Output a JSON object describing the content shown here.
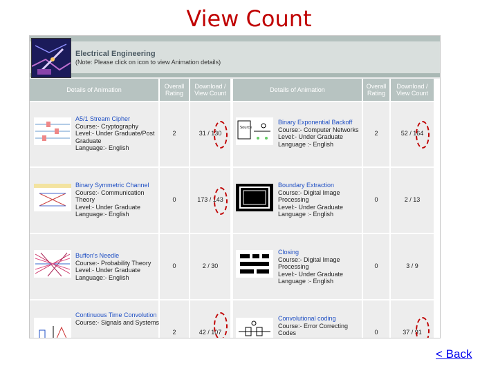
{
  "title": "View Count",
  "banner": {
    "dept": "Electrical Engineering",
    "note": "(Note: Please click on icon to view Animation details)"
  },
  "headers": {
    "details": "Details of Animation",
    "rating": "Overall Rating",
    "download": "Download / View Count"
  },
  "rows": [
    {
      "left": {
        "title": "A5/1 Stream Cipher",
        "course": "Course:- Cryptography",
        "level": "Level:- Under Graduate/Post Graduate",
        "language": "Language:- English",
        "rating": "2",
        "count": "31 / 130"
      },
      "right": {
        "title": "Binary Exponential Backoff",
        "course": "Course:- Computer Networks",
        "level": "Level:- Under Graduate",
        "language": "Language :- English",
        "rating": "2",
        "count": "52 / 164"
      }
    },
    {
      "left": {
        "title": "Binary Symmetric Channel",
        "course": "Course:- Communication Theory",
        "level": "Level:- Under Graduate",
        "language": "Language:- English",
        "rating": "0",
        "count": "173 / 143"
      },
      "right": {
        "title": "Boundary Extraction",
        "course": "Course:- Digital Image Processing",
        "level": "Level:- Under Graduate",
        "language": "Language :- English",
        "rating": "0",
        "count": "2 / 13"
      }
    },
    {
      "left": {
        "title": "Buffon's Needle",
        "course": "Course:- Probability Theory",
        "level": "Level:- Under Graduate",
        "language": "Language:- English",
        "rating": "0",
        "count": "2 / 30"
      },
      "right": {
        "title": "Closing",
        "course": "Course:- Digital Image Processing",
        "level": "Level:- Under Graduate",
        "language": "Language :- English",
        "rating": "0",
        "count": "3 / 9"
      }
    },
    {
      "left": {
        "title": "Continuous Time Convolution",
        "course": "Course:- Signals and Systems",
        "level": "",
        "language": "",
        "rating": "2",
        "count": "42 / 107"
      },
      "right": {
        "title": "Convolutional coding",
        "course": "Course:- Error Correcting Codes",
        "level": "",
        "language": "",
        "rating": "0",
        "count": "37 / 91"
      }
    }
  ],
  "back": "< Back",
  "colors": {
    "title": "#c00000",
    "link": "#1f4fc4",
    "header_bg": "#b7c3c1",
    "highlight": "#c00000"
  }
}
